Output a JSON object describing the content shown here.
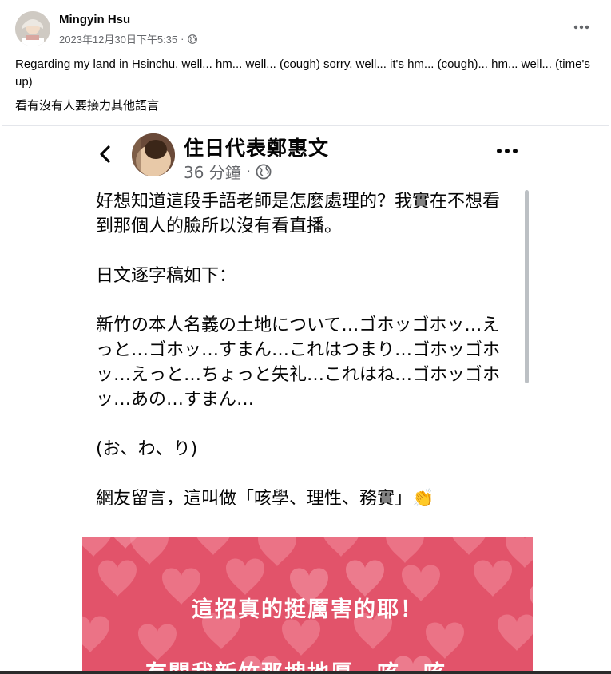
{
  "post": {
    "author": "Mingyin Hsu",
    "timestamp": "2023年12月30日下午5:35",
    "separator": "·",
    "privacy_icon": "globe-icon",
    "caption": "Regarding my land in Hsinchu, well... hm... well... (cough) sorry, well... it's hm... (cough)... hm... well... (time's up)",
    "caption_zh": "看有沒有人要接力其他語言"
  },
  "embedded_post": {
    "author": "住日代表鄭惠文",
    "time": "36 分鐘",
    "separator": "·",
    "body": "好想知道這段手語老師是怎麼處理的？我實在不想看到那個人的臉所以沒有看直播。\n\n日文逐字稿如下：\n\n新竹の本人名義の土地について…ゴホッゴホッ…えっと…ゴホッ…すまん…これはつまり…ゴホッゴホッ…えっと…ちょっと失礼…これはね…ゴホッゴホッ…あの…すまん…\n\n(お、わ、り)\n\n網友留言，這叫做「咳學、理性、務實」👏",
    "image_text_1": "這招真的挺厲害的耶！",
    "image_text_2": "有關我新竹那塊地厚，咳，咳，"
  },
  "colors": {
    "meta_gray": "#65676b",
    "text": "#050505",
    "heart_bg": "#e2536a"
  }
}
